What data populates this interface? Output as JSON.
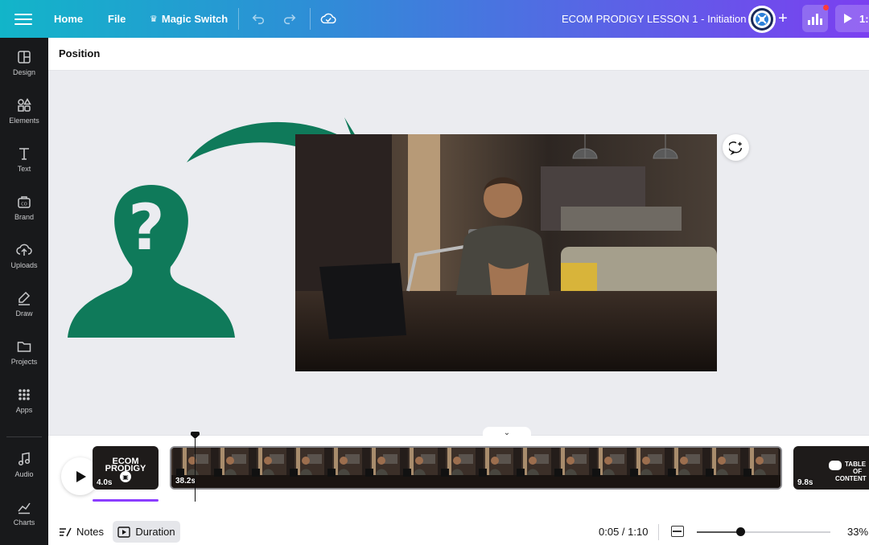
{
  "topbar": {
    "home": "Home",
    "file": "File",
    "magic_switch": "Magic Switch",
    "doc_title": "ECOM PRODIGY LESSON 1 - Initiation",
    "present_label": "1:"
  },
  "sidebar": {
    "items": [
      {
        "label": "Design",
        "icon": "design-icon"
      },
      {
        "label": "Elements",
        "icon": "elements-icon"
      },
      {
        "label": "Text",
        "icon": "text-icon"
      },
      {
        "label": "Brand",
        "icon": "brand-icon"
      },
      {
        "label": "Uploads",
        "icon": "uploads-icon"
      },
      {
        "label": "Draw",
        "icon": "draw-icon"
      },
      {
        "label": "Projects",
        "icon": "projects-icon"
      },
      {
        "label": "Apps",
        "icon": "apps-icon"
      },
      {
        "label": "Audio",
        "icon": "audio-icon"
      },
      {
        "label": "Charts",
        "icon": "charts-icon"
      }
    ]
  },
  "context_toolbar": {
    "position": "Position"
  },
  "canvas": {
    "shape_color": "#0f7a5a"
  },
  "timeline": {
    "clips": [
      {
        "title": "ECOM PRODIGY",
        "duration": "4.0s"
      },
      {
        "duration": "38.2s"
      },
      {
        "title_line1": "TABLE",
        "title_line2": "OF",
        "title_line3": "CONTENT",
        "duration": "9.8s"
      }
    ]
  },
  "footer": {
    "notes": "Notes",
    "duration": "Duration",
    "time": "0:05 / 1:10",
    "zoom": "33%",
    "zoom_level": 0.33
  },
  "colors": {
    "accent": "#8b3dff"
  }
}
